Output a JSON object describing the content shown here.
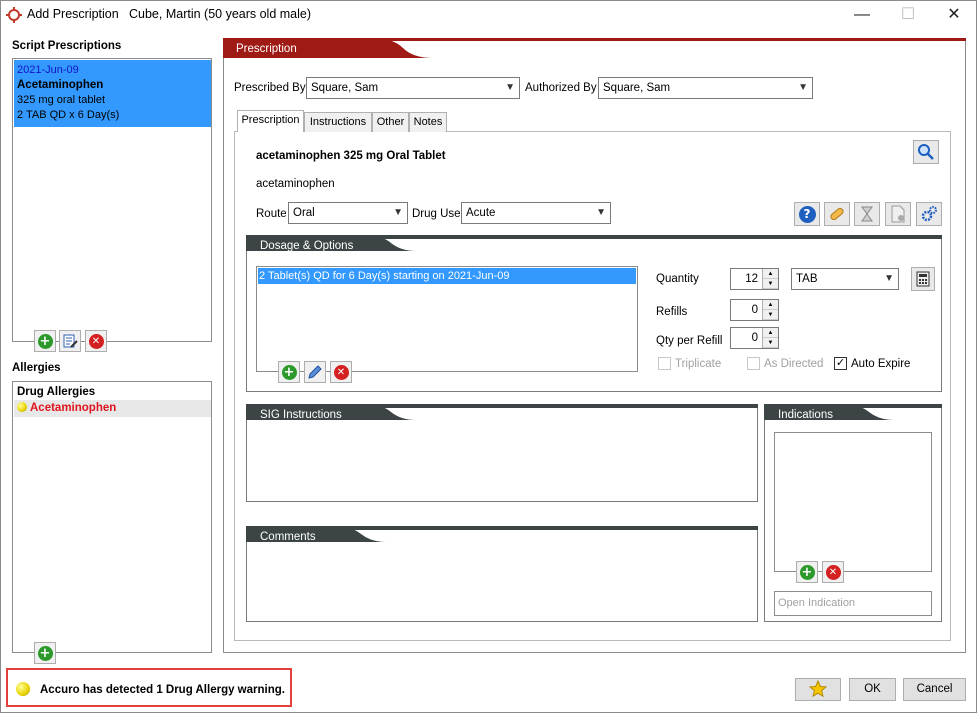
{
  "window": {
    "title": "Add Prescription",
    "patient": "Cube, Martin (50 years old male)",
    "controls": [
      "—",
      "☐",
      "✕"
    ]
  },
  "left": {
    "script_label": "Script Prescriptions",
    "script_items": [
      {
        "date": "2021-Jun-09",
        "name": "Acetaminophen",
        "strength": "325 mg oral tablet",
        "sig": "2 TAB QD x 6 Day(s)"
      }
    ],
    "allergies_label": "Allergies",
    "allergy_group": "Drug Allergies",
    "allergy_items": [
      "Acetaminophen"
    ]
  },
  "prescription": {
    "header": "Prescription",
    "prescribed_by_label": "Prescribed By",
    "prescribed_by": "Square, Sam",
    "authorized_by_label": "Authorized By",
    "authorized_by": "Square, Sam",
    "tabs": [
      "Prescription",
      "Instructions",
      "Other",
      "Notes"
    ],
    "drug_title": "acetaminophen 325 mg Oral Tablet",
    "drug_generic": "acetaminophen",
    "route_label": "Route",
    "route": "Oral",
    "drug_use_label": "Drug Use",
    "drug_use": "Acute"
  },
  "dosage": {
    "header": "Dosage & Options",
    "items": [
      "2 Tablet(s) QD for 6 Day(s)  starting on 2021-Jun-09"
    ],
    "quantity_label": "Quantity",
    "quantity": "12",
    "unit": "TAB",
    "refills_label": "Refills",
    "refills": "0",
    "qty_per_refill_label": "Qty per Refill",
    "qty_per_refill": "0",
    "triplicate_label": "Triplicate",
    "as_directed_label": "As Directed",
    "auto_expire_label": "Auto Expire",
    "auto_expire_checked": true
  },
  "sig": {
    "header": "SIG Instructions"
  },
  "comments": {
    "header": "Comments"
  },
  "indications": {
    "header": "Indications",
    "placeholder": "Open Indication"
  },
  "footer": {
    "warning": "Accuro has detected 1 Drug Allergy warning.",
    "ok_label": "OK",
    "cancel_label": "Cancel"
  },
  "colors": {
    "header_red": "#a01a15",
    "group_dark": "#3c4446",
    "selection_blue": "#3399ff",
    "allergy_red": "#e0141e",
    "warning_border": "#e0413b"
  }
}
